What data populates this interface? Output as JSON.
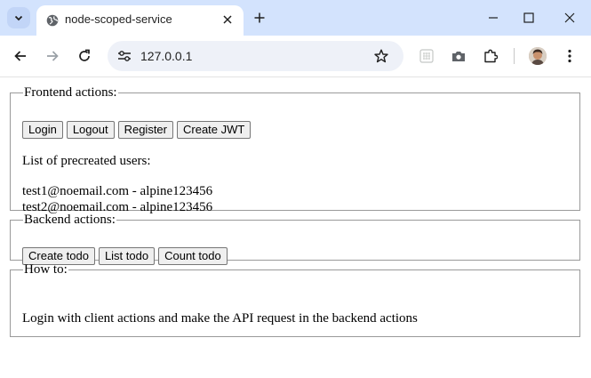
{
  "browser": {
    "tab_title": "node-scoped-service",
    "url": "127.0.0.1",
    "icons": {
      "tab_search": "chevron-down-icon",
      "favicon": "globe-icon",
      "tab_close": "close-icon",
      "new_tab": "plus-icon",
      "minimize": "minimize-icon",
      "maximize": "maximize-icon",
      "close_window": "close-icon",
      "back": "arrow-left-icon",
      "forward": "arrow-right-icon",
      "reload": "reload-icon",
      "site_info": "tune-icon",
      "bookmark": "star-icon",
      "extension_1": "extension-grid-icon",
      "screenshot": "camera-icon",
      "extensions": "puzzle-icon",
      "profile": "avatar-icon",
      "menu": "kebab-menu-icon"
    },
    "colors": {
      "tab_strip": "#d3e3fd",
      "omnibox": "#eef1f8"
    }
  },
  "frontend": {
    "legend": "Frontend actions:",
    "buttons": [
      "Login",
      "Logout",
      "Register",
      "Create JWT"
    ],
    "users_heading": "List of precreated users:",
    "users": [
      "test1@noemail.com - alpine123456",
      "test2@noemail.com - alpine123456"
    ]
  },
  "backend": {
    "legend": "Backend actions:",
    "buttons": [
      "Create todo",
      "List todo",
      "Count todo"
    ]
  },
  "howto": {
    "legend": "How to:",
    "text": "Login with client actions and make the API request in the backend actions"
  }
}
